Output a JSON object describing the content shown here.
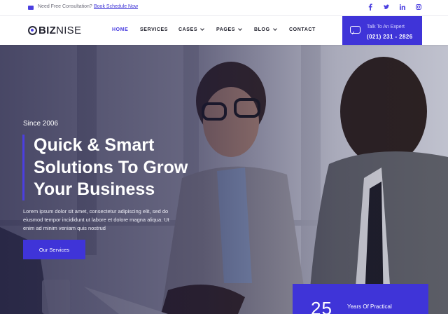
{
  "topbar": {
    "consult_text": "Need Free Consultation?",
    "book_link": "Book Schedule Now",
    "social_icons": [
      "facebook-icon",
      "twitter-icon",
      "linkedin-icon",
      "instagram-icon"
    ]
  },
  "nav": {
    "logo_bold": "BIZ",
    "logo_light": "NISE",
    "items": [
      {
        "label": "HOME",
        "active": true,
        "dropdown": false
      },
      {
        "label": "SERVICES",
        "active": false,
        "dropdown": false
      },
      {
        "label": "CASES",
        "active": false,
        "dropdown": true
      },
      {
        "label": "PAGES",
        "active": false,
        "dropdown": true
      },
      {
        "label": "BLOG",
        "active": false,
        "dropdown": true
      },
      {
        "label": "CONTACT",
        "active": false,
        "dropdown": false
      }
    ],
    "expert_label": "Talk To An Expert",
    "expert_phone": "(021) 231 - 2826"
  },
  "hero": {
    "since": "Since 2006",
    "headline_lines": [
      "Quick & Smart",
      "Solutions To Grow",
      "Your Business"
    ],
    "description": "Lorem ipsum dolor sit amet, consectetur adipiscing elit, sed do eiusmod tempor incididunt ut labore et dolore magna aliqua. Ut enim ad minim veniam quis nostrud",
    "cta_label": "Our Services",
    "stat_number": "25",
    "stat_text": "Years Of Practical"
  },
  "colors": {
    "accent": "#3f34d8",
    "dark_text": "#1f1f2b"
  }
}
